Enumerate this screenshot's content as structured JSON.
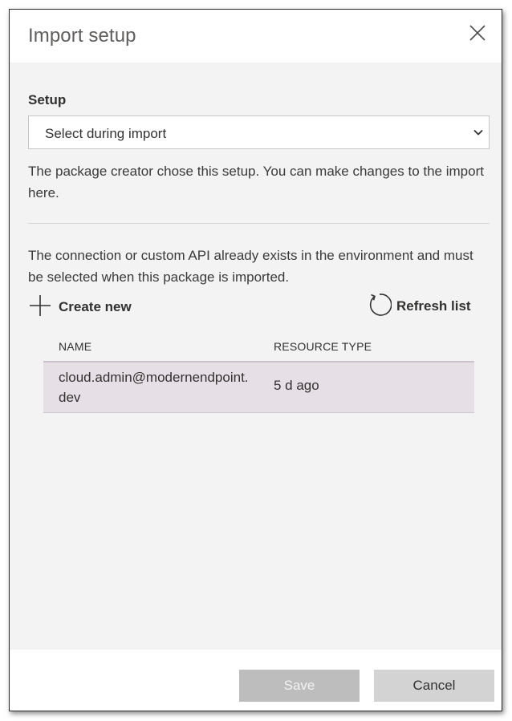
{
  "dialog": {
    "title": "Import setup",
    "close_icon": "close-icon"
  },
  "setup": {
    "label": "Setup",
    "selected_value": "Select during import",
    "description": "The package creator chose this setup. You can make changes to the import here."
  },
  "connection": {
    "description": "The connection or custom API already exists in the environment and must be selected when this package is imported.",
    "create_new_label": "Create new",
    "refresh_label": "Refresh list",
    "icons": {
      "create": "plus-icon",
      "refresh": "refresh-icon"
    }
  },
  "table": {
    "columns": [
      "NAME",
      "RESOURCE TYPE"
    ],
    "rows": [
      {
        "name": "cloud.admin@modernendpoint.dev",
        "type": "5 d ago"
      }
    ],
    "selected_row_color": "#e6dfe6"
  },
  "footer": {
    "save_label": "Save",
    "cancel_label": "Cancel"
  }
}
